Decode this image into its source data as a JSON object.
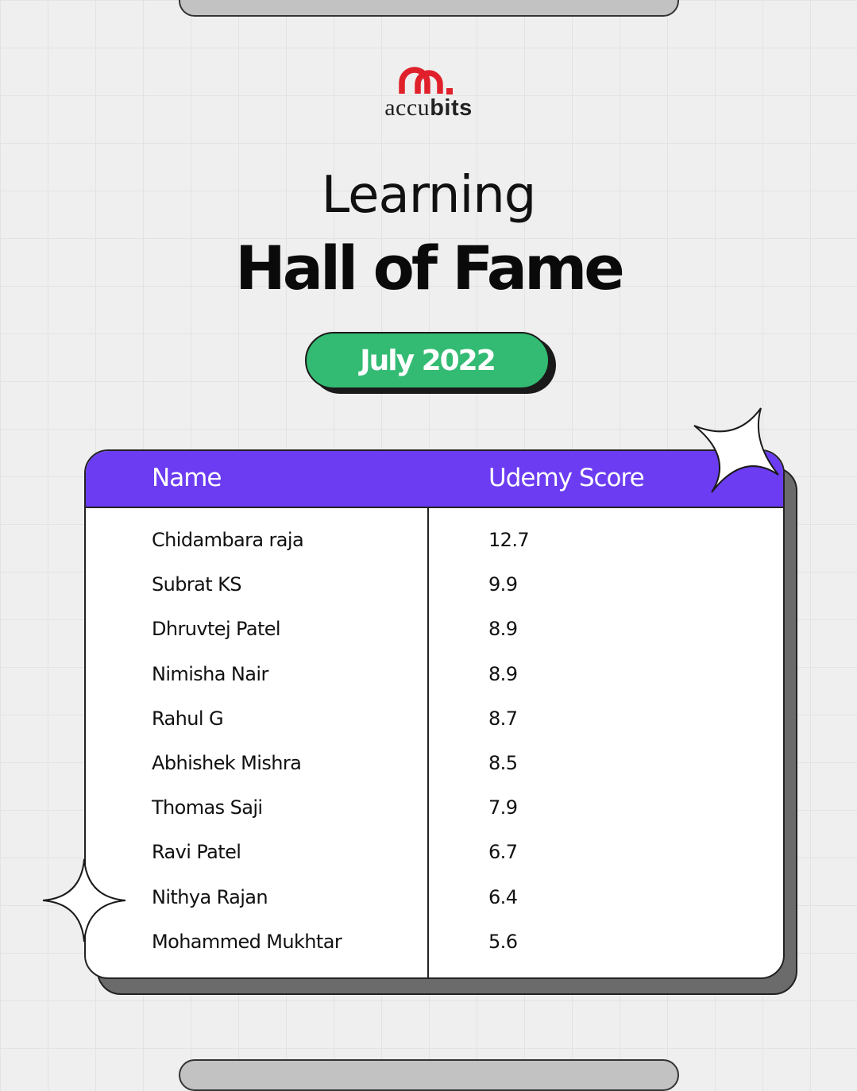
{
  "brand": {
    "logo_text_regular": "accu",
    "logo_text_bold": "bits",
    "accent_color": "#e0202a"
  },
  "title": {
    "line1": "Learning",
    "line2": "Hall of Fame"
  },
  "month_badge": {
    "label": "July 2022",
    "color": "#33bb73"
  },
  "table": {
    "header_color": "#6b3cf2",
    "columns": [
      "Name",
      "Udemy Score"
    ],
    "rows": [
      {
        "name": "Chidambara raja",
        "score": "12.7"
      },
      {
        "name": "Subrat KS",
        "score": "9.9"
      },
      {
        "name": "Dhruvtej Patel",
        "score": "8.9"
      },
      {
        "name": "Nimisha Nair",
        "score": "8.9"
      },
      {
        "name": "Rahul G",
        "score": "8.7"
      },
      {
        "name": "Abhishek Mishra",
        "score": "8.5"
      },
      {
        "name": "Thomas Saji",
        "score": "7.9"
      },
      {
        "name": "Ravi Patel",
        "score": "6.7"
      },
      {
        "name": "Nithya Rajan",
        "score": "6.4"
      },
      {
        "name": "Mohammed Mukhtar",
        "score": "5.6"
      }
    ]
  },
  "decorations": [
    "sparkle-icon",
    "sparkle-icon"
  ]
}
